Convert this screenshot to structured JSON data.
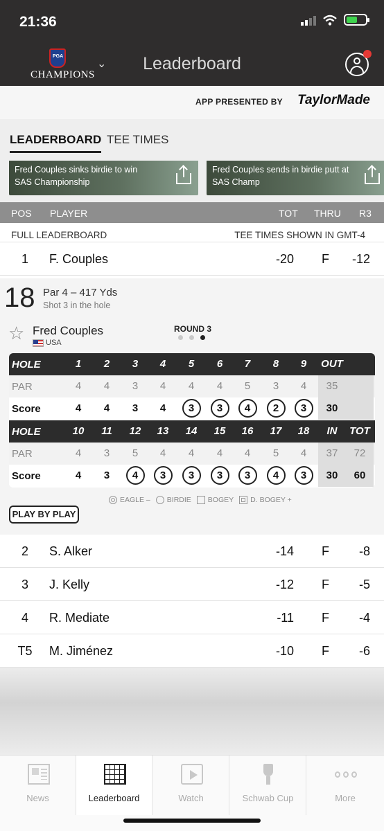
{
  "status_bar": {
    "time": "21:36"
  },
  "header": {
    "logo_text": "CHAMPIONS",
    "title": "Leaderboard"
  },
  "sponsor": {
    "presented_by": "APP PRESENTED BY",
    "brand": "TaylorMade"
  },
  "tabs": [
    {
      "label": "LEADERBOARD"
    },
    {
      "label": "TEE TIMES"
    }
  ],
  "videos": [
    {
      "title": "Fred Couples sinks birdie to win SAS Championship"
    },
    {
      "title": "Fred Couples sends in birdie putt at SAS Champ"
    }
  ],
  "columns": {
    "pos": "POS",
    "player": "PLAYER",
    "tot": "TOT",
    "thru": "THRU",
    "r3": "R3"
  },
  "full_leaderboard": {
    "label": "FULL LEADERBOARD",
    "tee_times_note": "TEE TIMES SHOWN IN GMT-4"
  },
  "leader": {
    "pos": "1",
    "player": "F. Couples",
    "tot": "-20",
    "thru": "F",
    "r3": "-12"
  },
  "hole_detail": {
    "hole": "18",
    "info": "Par 4 – 417 Yds",
    "shot": "Shot 3 in the hole",
    "player_name": "Fred Couples",
    "country": "USA",
    "round_label": "ROUND 3",
    "round_total": 3,
    "round_current": 3
  },
  "scorecard": {
    "hole_label": "HOLE",
    "par_label": "PAR",
    "score_label": "Score",
    "front": {
      "holes": [
        "1",
        "2",
        "3",
        "4",
        "5",
        "6",
        "7",
        "8",
        "9"
      ],
      "par": [
        "4",
        "4",
        "3",
        "4",
        "4",
        "4",
        "5",
        "3",
        "4"
      ],
      "score": [
        "4",
        "4",
        "3",
        "4",
        "3",
        "3",
        "4",
        "2",
        "3"
      ],
      "circled": [
        false,
        false,
        false,
        false,
        true,
        true,
        true,
        true,
        true
      ],
      "out_label": "OUT",
      "par_out": "35",
      "score_out": "30"
    },
    "back": {
      "holes": [
        "10",
        "11",
        "12",
        "13",
        "14",
        "15",
        "16",
        "17",
        "18"
      ],
      "par": [
        "4",
        "3",
        "5",
        "4",
        "4",
        "4",
        "4",
        "5",
        "4"
      ],
      "score": [
        "4",
        "3",
        "4",
        "3",
        "3",
        "3",
        "3",
        "4",
        "3"
      ],
      "circled": [
        false,
        false,
        true,
        true,
        true,
        true,
        true,
        true,
        true
      ],
      "in_label": "IN",
      "tot_label": "TOT",
      "par_in": "37",
      "par_tot": "72",
      "score_in": "30",
      "score_tot": "60"
    }
  },
  "legend": {
    "eagle": "EAGLE –",
    "birdie": "BIRDIE",
    "bogey": "BOGEY",
    "dbogey": "D. BOGEY +"
  },
  "play_by_play": "PLAY BY PLAY",
  "players": [
    {
      "pos": "2",
      "player": "S. Alker",
      "tot": "-14",
      "thru": "F",
      "r3": "-8"
    },
    {
      "pos": "3",
      "player": "J. Kelly",
      "tot": "-12",
      "thru": "F",
      "r3": "-5"
    },
    {
      "pos": "4",
      "player": "R. Mediate",
      "tot": "-11",
      "thru": "F",
      "r3": "-4"
    },
    {
      "pos": "T5",
      "player": "M. Jiménez",
      "tot": "-10",
      "thru": "F",
      "r3": "-6"
    }
  ],
  "tabbar": [
    {
      "label": "News",
      "icon": "news-icon"
    },
    {
      "label": "Leaderboard",
      "icon": "leaderboard-icon"
    },
    {
      "label": "Watch",
      "icon": "watch-icon"
    },
    {
      "label": "Schwab Cup",
      "icon": "trophy-icon"
    },
    {
      "label": "More",
      "icon": "more-icon"
    }
  ],
  "colors": {
    "header_bg": "#2f2d2d",
    "accent_badge": "#e53935",
    "column_header": "#8e8e8e",
    "scorecard_dark": "#2c2c2c"
  }
}
